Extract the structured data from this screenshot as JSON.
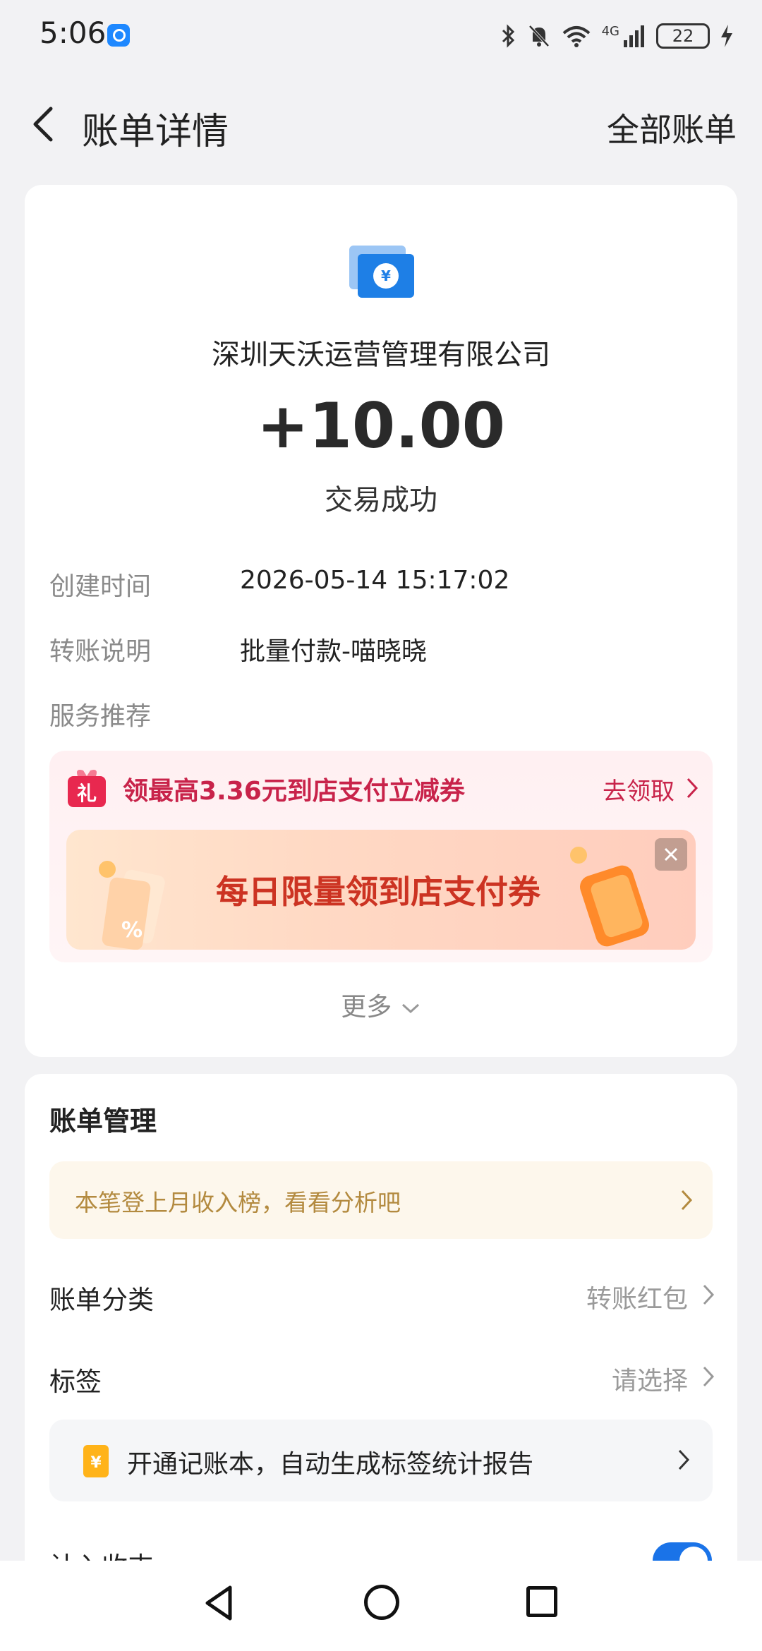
{
  "status_bar": {
    "time": "5:06",
    "network": "4G",
    "battery": "22"
  },
  "header": {
    "title": "账单详情",
    "right_action": "全部账单"
  },
  "transaction": {
    "merchant": "深圳天沃运营管理有限公司",
    "amount": "+10.00",
    "status": "交易成功",
    "details": [
      {
        "label": "创建时间",
        "value": "2026-05-14 15:17:02"
      },
      {
        "label": "转账说明",
        "value": "批量付款-喵晓晓"
      }
    ],
    "service_label": "服务推荐"
  },
  "promo": {
    "text": "领最高3.36元到店支付立减券",
    "action": "去领取",
    "banner_text": "每日限量领到店支付券",
    "more": "更多"
  },
  "management": {
    "title": "账单管理",
    "insight": "本笔登上月收入榜，看看分析吧",
    "category_label": "账单分类",
    "category_value": "转账红包",
    "tag_label": "标签",
    "tag_value": "请选择",
    "ledger_text": "开通记账本，自动生成标签统计报告",
    "income_label": "计入收支"
  },
  "colors": {
    "accent": "#1a73e8",
    "promo_red": "#c8234a",
    "insight_gold": "#b38a3f"
  }
}
